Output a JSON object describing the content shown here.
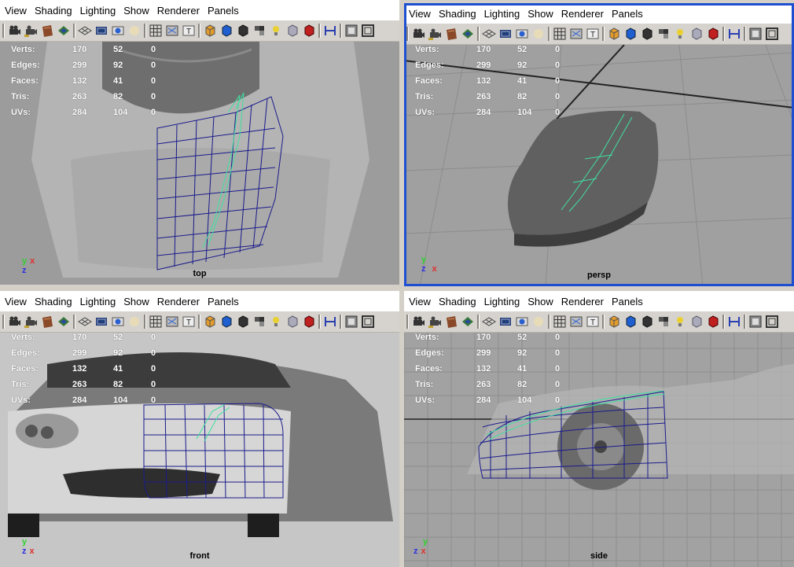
{
  "menu": [
    "View",
    "Shading",
    "Lighting",
    "Show",
    "Renderer",
    "Panels"
  ],
  "stats": [
    {
      "label": "Verts:",
      "a": "170",
      "b": "52",
      "c": "0"
    },
    {
      "label": "Edges:",
      "a": "299",
      "b": "92",
      "c": "0"
    },
    {
      "label": "Faces:",
      "a": "132",
      "b": "41",
      "c": "0"
    },
    {
      "label": "Tris:",
      "a": "263",
      "b": "82",
      "c": "0"
    },
    {
      "label": "UVs:",
      "a": "284",
      "b": "104",
      "c": "0"
    }
  ],
  "views": {
    "top": {
      "label": "top",
      "axes": [
        "y",
        "x",
        "z"
      ]
    },
    "persp": {
      "label": "persp",
      "axes": [
        "y",
        "x",
        "z"
      ]
    },
    "front": {
      "label": "front",
      "axes": [
        "y",
        "z",
        "x"
      ]
    },
    "side": {
      "label": "side",
      "axes": [
        "y",
        "z",
        "x"
      ]
    }
  },
  "colors": {
    "active_border": "#1e4fd0",
    "wireframe": "#1a1a8c",
    "selected_edges": "#40e0a0",
    "axis_x": "#e03030",
    "axis_y": "#30d030",
    "axis_z": "#3030e0"
  },
  "toolbar_icons": [
    "camera-icon",
    "camera-attr-icon",
    "bookmark-icon",
    "image-plane-icon",
    "grid-icon",
    "film-gate-icon",
    "resolution-gate-icon",
    "safe-action-icon",
    "wireframe-icon",
    "smooth-shade-icon",
    "textured-icon",
    "lights-icon",
    "shadows-icon",
    "isolate-icon",
    "frame-all-icon",
    "frame-selected-icon"
  ]
}
